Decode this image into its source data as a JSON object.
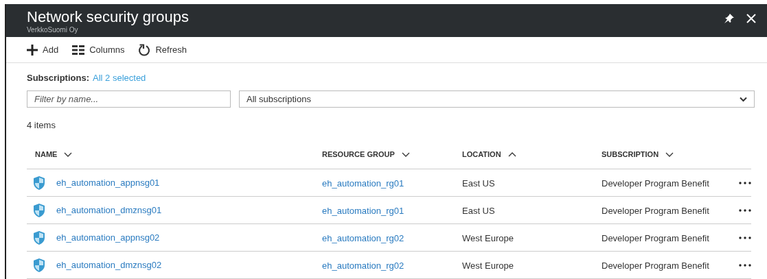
{
  "blade": {
    "title": "Network security groups",
    "subtitle": "VerkkoSuomi Oy"
  },
  "toolbar": [
    {
      "kind": "add",
      "label": "Add"
    },
    {
      "kind": "columns",
      "label": "Columns"
    },
    {
      "kind": "refresh",
      "label": "Refresh"
    }
  ],
  "subscriptions": {
    "label": "Subscriptions:",
    "value": "All 2 selected"
  },
  "filter": {
    "placeholder": "Filter by name..."
  },
  "subscription_select": {
    "value": "All subscriptions"
  },
  "count": "4 items",
  "table": {
    "columns": [
      {
        "label": "NAME",
        "ascending": false
      },
      {
        "label": "RESOURCE GROUP",
        "ascending": false
      },
      {
        "label": "LOCATION",
        "ascending": true
      },
      {
        "label": "SUBSCRIPTION",
        "ascending": false
      }
    ],
    "rows": [
      {
        "name": "eh_automation_appnsg01",
        "resource_group": "eh_automation_rg01",
        "location": "East US",
        "subscription": "Developer Program Benefit"
      },
      {
        "name": "eh_automation_dmznsg01",
        "resource_group": "eh_automation_rg01",
        "location": "East US",
        "subscription": "Developer Program Benefit"
      },
      {
        "name": "eh_automation_appnsg02",
        "resource_group": "eh_automation_rg02",
        "location": "West Europe",
        "subscription": "Developer Program Benefit"
      },
      {
        "name": "eh_automation_dmznsg02",
        "resource_group": "eh_automation_rg02",
        "location": "West Europe",
        "subscription": "Developer Program Benefit"
      }
    ]
  }
}
